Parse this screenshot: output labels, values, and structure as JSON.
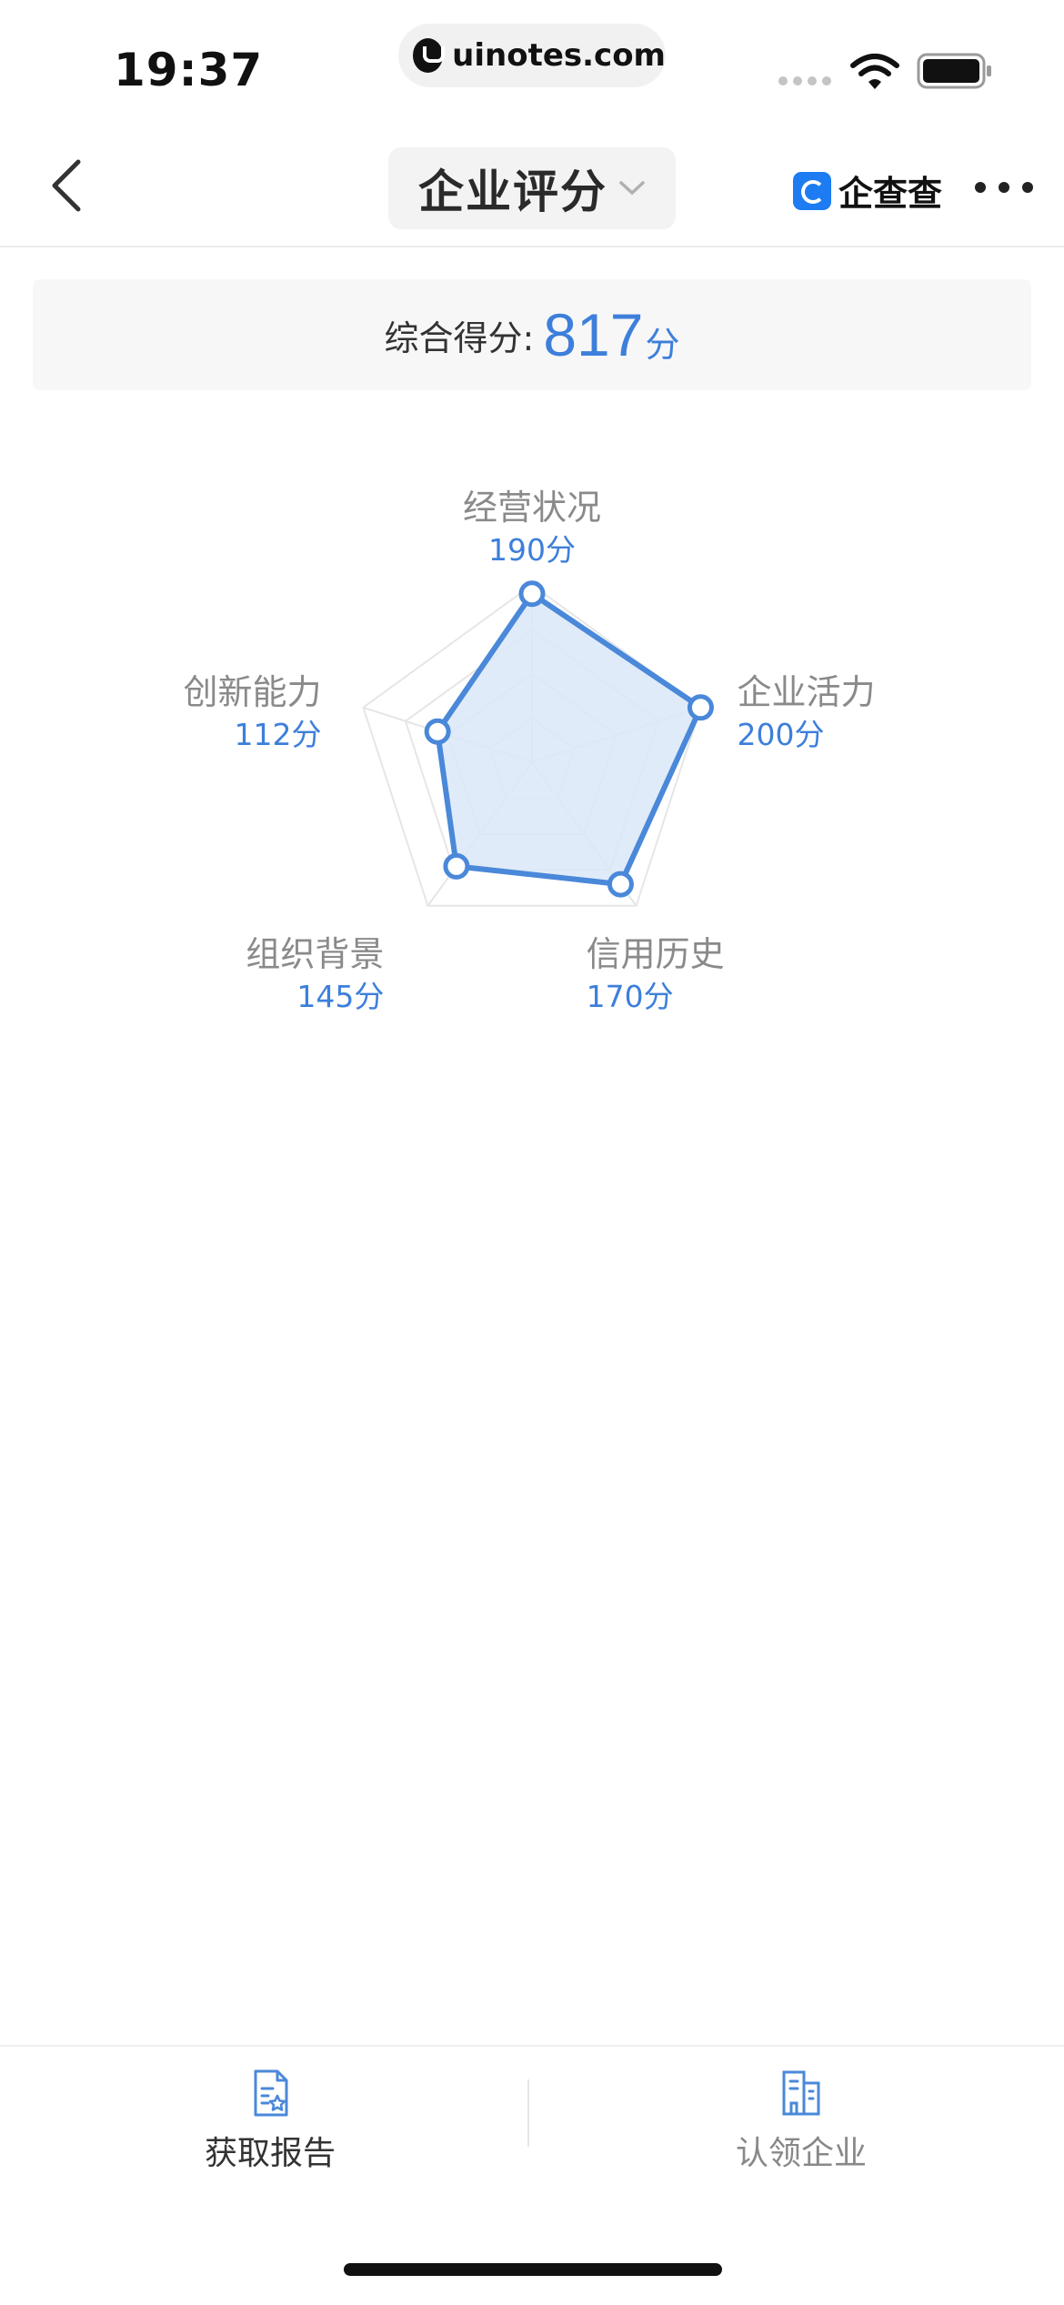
{
  "status_bar": {
    "time": "19:37",
    "url": "uinotes.com"
  },
  "nav": {
    "title": "企业评分",
    "brand_name": "企查查"
  },
  "score_card": {
    "label": "综合得分:",
    "value": "817",
    "unit": "分"
  },
  "chart_data": {
    "type": "radar",
    "max": 200,
    "rings": 4,
    "axes": [
      {
        "label": "经营状况",
        "value": 190,
        "value_text": "190分"
      },
      {
        "label": "企业活力",
        "value": 200,
        "value_text": "200分"
      },
      {
        "label": "信用历史",
        "value": 170,
        "value_text": "170分"
      },
      {
        "label": "组织背景",
        "value": 145,
        "value_text": "145分"
      },
      {
        "label": "创新能力",
        "value": 112,
        "value_text": "112分"
      }
    ],
    "colors": {
      "line": "#4a88d9",
      "fill": "#dbe8f8",
      "grid": "#e6e6e6"
    }
  },
  "bottom_bar": {
    "get_report_label": "获取报告",
    "claim_company_label": "认领企业",
    "get_report_color": "#333333",
    "claim_company_color": "#888888",
    "icon_color": "#4a88d9"
  }
}
